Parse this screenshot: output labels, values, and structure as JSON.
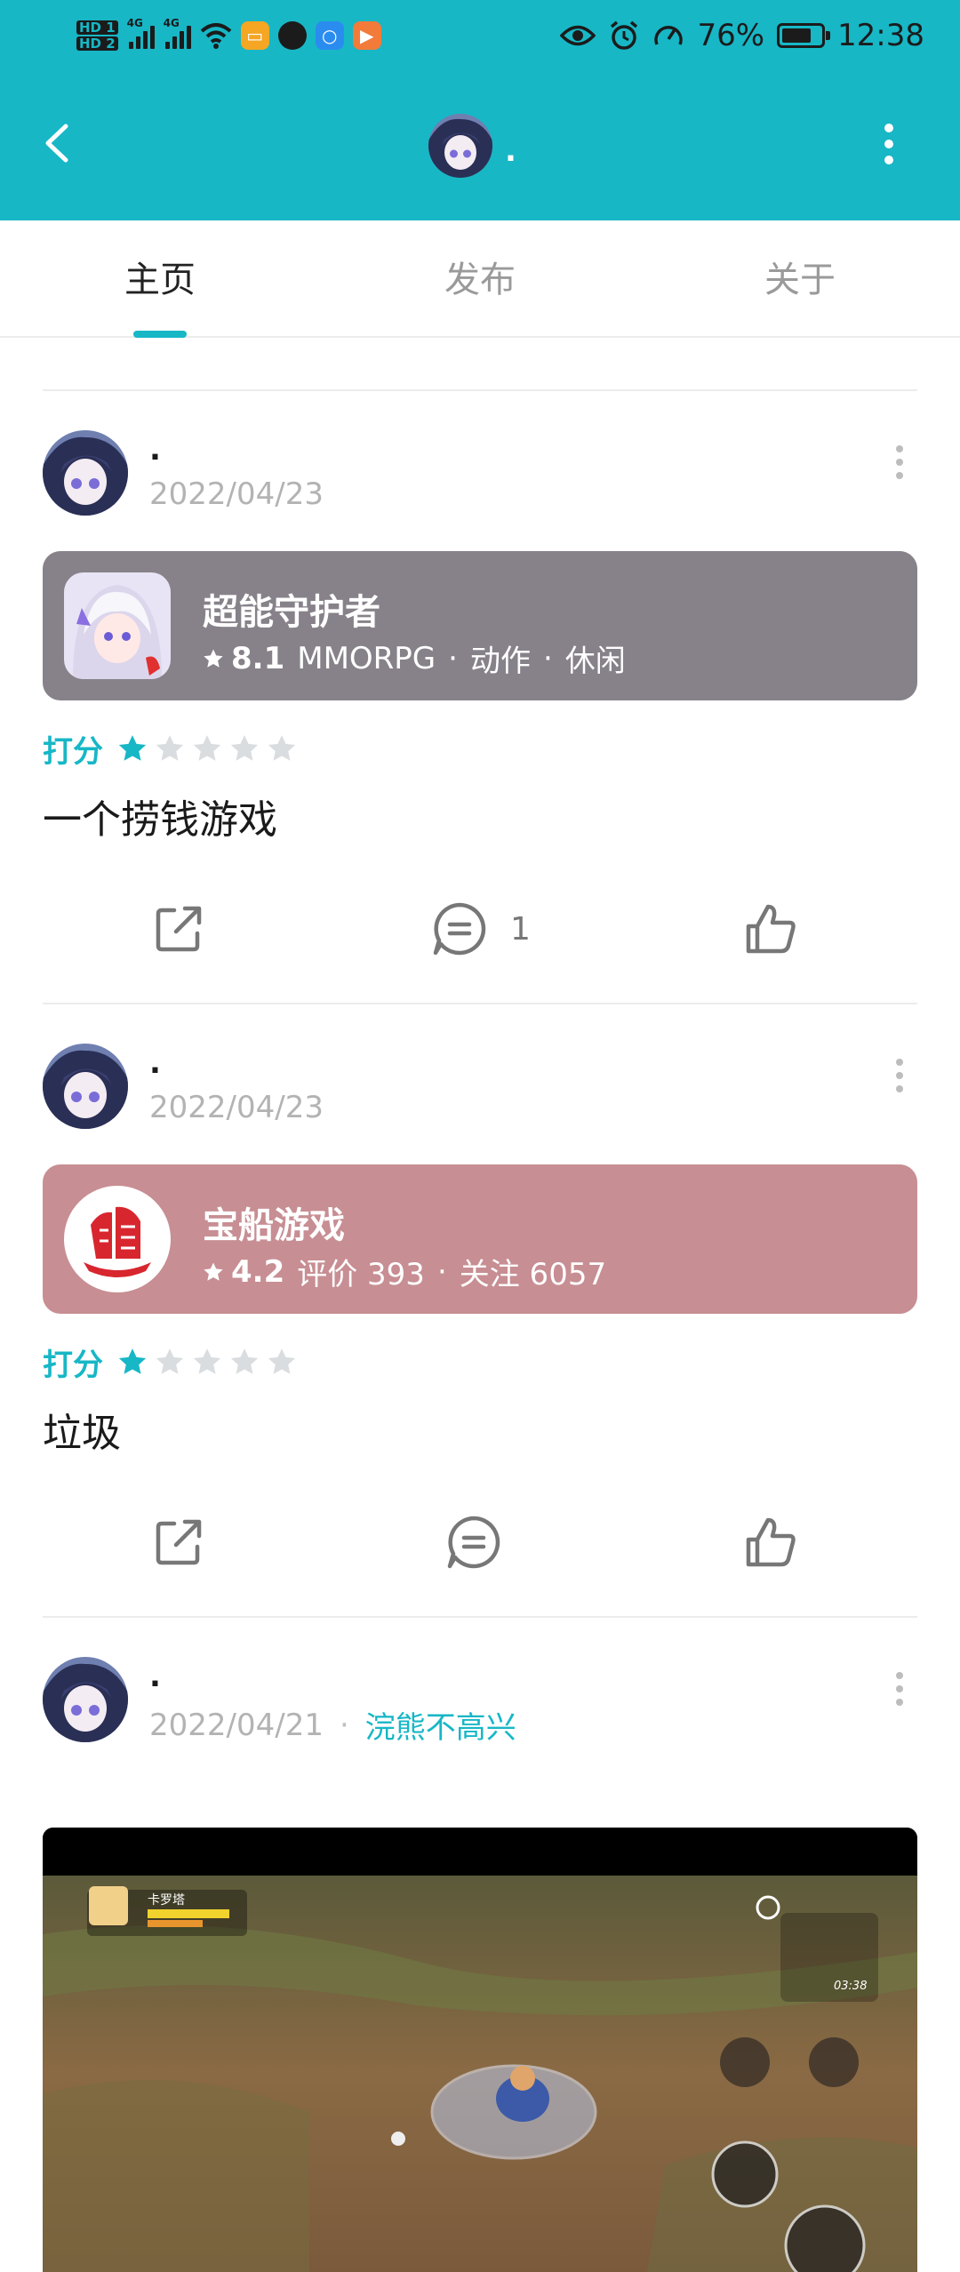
{
  "status_bar": {
    "hd1": "HD 1",
    "hd2": "HD 2",
    "net1": "4G",
    "net2": "4G",
    "battery_percent": "76%",
    "battery_level": 0.76,
    "time": "12:38"
  },
  "header": {
    "name": "."
  },
  "tabs": [
    {
      "label": "主页",
      "active": true
    },
    {
      "label": "发布",
      "active": false
    },
    {
      "label": "关于",
      "active": false
    }
  ],
  "posts": [
    {
      "author": ".",
      "date": "2022/04/23",
      "game": {
        "name": "超能守护者",
        "score": "8.1",
        "tags": [
          "MMORPG",
          "动作",
          "休闲"
        ],
        "card_color": "#878189"
      },
      "rating_label": "打分",
      "rating": 1,
      "text": "一个捞钱游戏",
      "comment_count": "1"
    },
    {
      "author": ".",
      "date": "2022/04/23",
      "game": {
        "name": "宝船游戏",
        "score": "4.2",
        "reviews": "评价 393",
        "followers": "关注 6057",
        "card_color": "#c78e93"
      },
      "rating_label": "打分",
      "rating": 1,
      "text": "垃圾",
      "comment_count": ""
    },
    {
      "author": ".",
      "date": "2022/04/21",
      "source": "浣熊不高兴",
      "video": {
        "hero_name": "卡罗塔",
        "timer": "03:38"
      }
    }
  ],
  "colors": {
    "accent": "#17b7c6",
    "star_inactive": "#d9dde0"
  }
}
